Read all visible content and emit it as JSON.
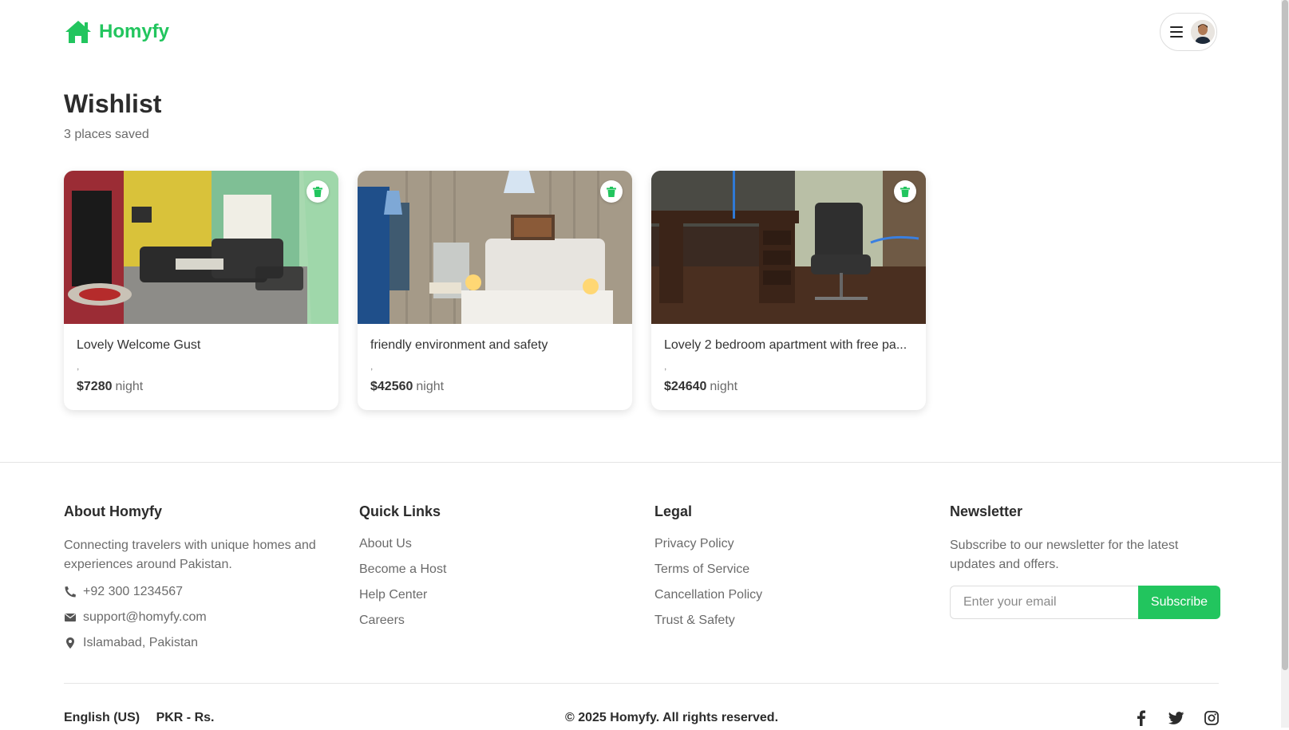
{
  "brand": {
    "name": "Homyfy",
    "accent_color": "#22c55e"
  },
  "header": {
    "menu_icon": "hamburger-icon",
    "avatar": "user-avatar"
  },
  "wishlist": {
    "title": "Wishlist",
    "subtitle": "3 places saved",
    "cards": [
      {
        "title": "Lovely Welcome Gust",
        "location": ",",
        "price": "$7280",
        "unit": "night",
        "image": "living-room-photo",
        "remove_icon": "trash-icon"
      },
      {
        "title": "friendly environment and safety",
        "location": ",",
        "price": "$42560",
        "unit": "night",
        "image": "bedroom-photo",
        "remove_icon": "trash-icon"
      },
      {
        "title": "Lovely 2 bedroom apartment with free pa...",
        "location": ",",
        "price": "$24640",
        "unit": "night",
        "image": "office-desk-photo",
        "remove_icon": "trash-icon"
      }
    ]
  },
  "footer": {
    "about": {
      "heading": "About Homyfy",
      "text": "Connecting travelers with unique homes and experiences around Pakistan.",
      "phone": "+92 300 1234567",
      "email": "support@homyfy.com",
      "location": "Islamabad, Pakistan"
    },
    "quick_links": {
      "heading": "Quick Links",
      "items": [
        "About Us",
        "Become a Host",
        "Help Center",
        "Careers"
      ]
    },
    "legal": {
      "heading": "Legal",
      "items": [
        "Privacy Policy",
        "Terms of Service",
        "Cancellation Policy",
        "Trust & Safety"
      ]
    },
    "newsletter": {
      "heading": "Newsletter",
      "text": "Subscribe to our newsletter for the latest updates and offers.",
      "placeholder": "Enter your email",
      "button": "Subscribe"
    },
    "language": "English (US)",
    "currency": "PKR - Rs.",
    "copyright": "© 2025 Homyfy. All rights reserved.",
    "socials": [
      "facebook-icon",
      "twitter-icon",
      "instagram-icon"
    ]
  }
}
